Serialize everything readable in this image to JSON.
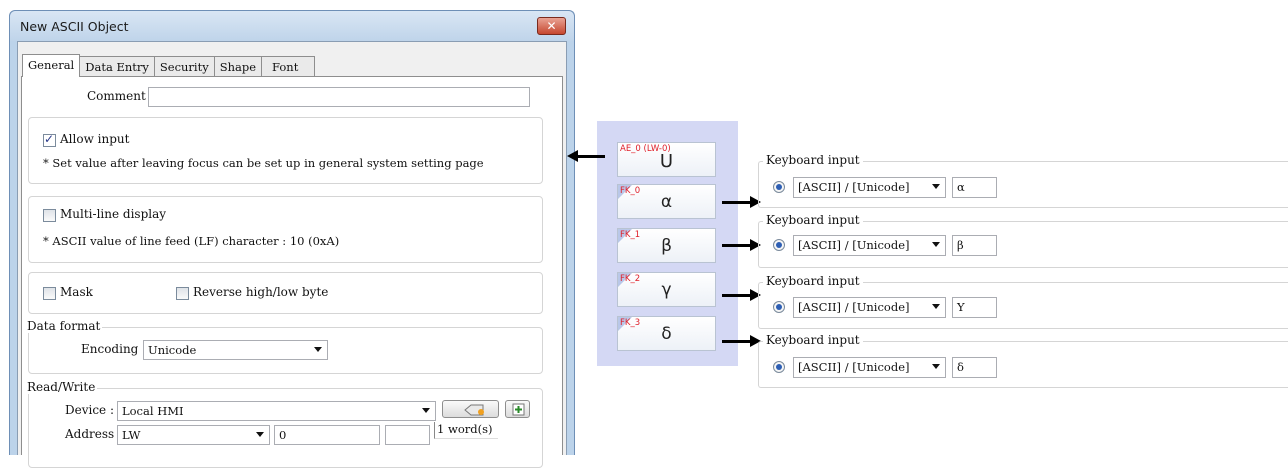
{
  "dialog": {
    "title": "New ASCII Object",
    "close_glyph": "✕",
    "tabs": [
      "General",
      "Data Entry",
      "Security",
      "Shape",
      "Font"
    ]
  },
  "general": {
    "comment_label": "Comment :",
    "comment_value": "",
    "allow_input_label": "Allow input",
    "allow_input_checked": true,
    "allow_input_note": "* Set value after leaving focus can be set up in general system setting page",
    "multiline_label": "Multi-line display",
    "multiline_checked": false,
    "lf_note": "* ASCII value of line feed (LF) character : 10 (0xA)",
    "mask_label": "Mask",
    "reverse_label": "Reverse high/low byte",
    "data_format_legend": "Data format",
    "encoding_label": "Encoding :",
    "encoding_value": "Unicode",
    "rw_legend": "Read/Write",
    "device_label": "Device :",
    "device_value": "Local HMI",
    "address_label": "Address :",
    "address_type": "LW",
    "address_value": "0",
    "word_count": "1 word(s)"
  },
  "hmi": {
    "display": {
      "tag": "AE_0 (LW-0)",
      "glyph": "U"
    },
    "keys": [
      {
        "tag": "FK_0",
        "glyph": "α"
      },
      {
        "tag": "FK_1",
        "glyph": "β"
      },
      {
        "tag": "FK_2",
        "glyph": "γ"
      },
      {
        "tag": "FK_3",
        "glyph": "δ"
      }
    ]
  },
  "keyboard_inputs": [
    {
      "legend": "Keyboard input",
      "mode": "[ASCII] / [Unicode]",
      "value": "α"
    },
    {
      "legend": "Keyboard input",
      "mode": "[ASCII] / [Unicode]",
      "value": "β"
    },
    {
      "legend": "Keyboard input",
      "mode": "[ASCII] / [Unicode]",
      "value": "Υ"
    },
    {
      "legend": "Keyboard input",
      "mode": "[ASCII] / [Unicode]",
      "value": "δ"
    }
  ]
}
